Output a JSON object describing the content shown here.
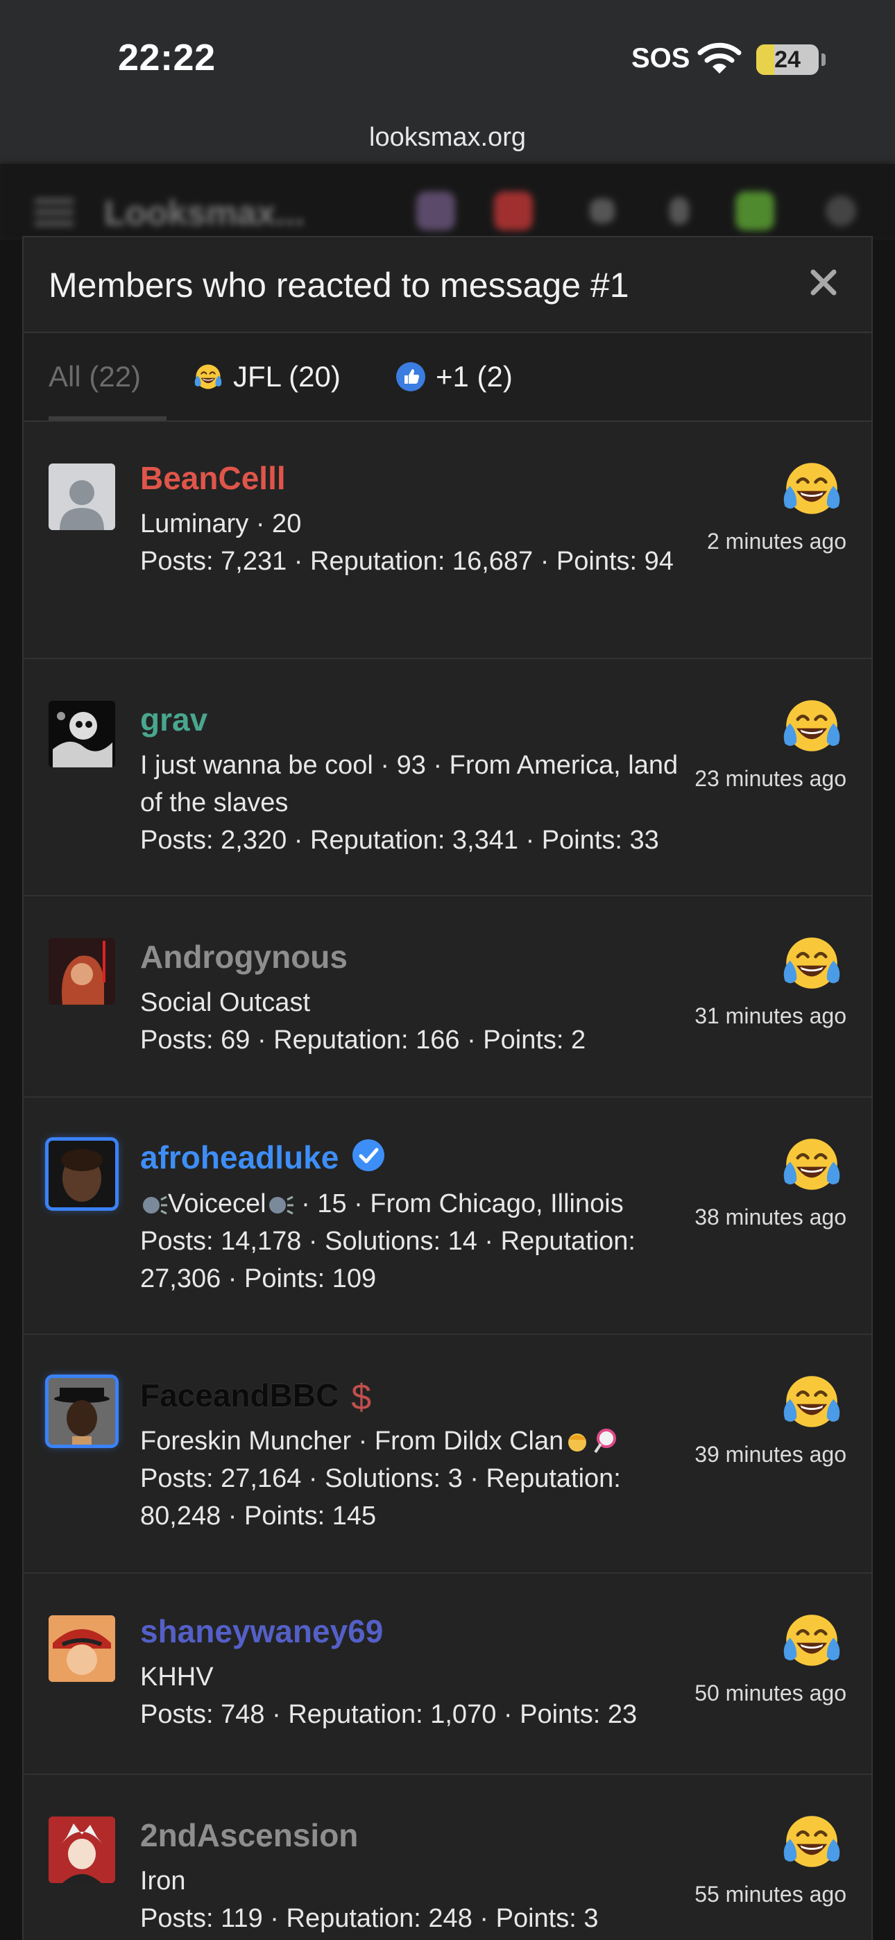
{
  "status_bar": {
    "time": "22:22",
    "sos": "SOS",
    "battery": "24"
  },
  "browser": {
    "url": "looksmax.org"
  },
  "site": {
    "logo": "Looksmax..."
  },
  "modal": {
    "title": "Members who reacted to message #1",
    "tabs": [
      {
        "label": "All (22)"
      },
      {
        "label": "JFL (20)",
        "icon": "laughing-crying-emoji-icon"
      },
      {
        "label": "+1 (2)",
        "icon": "thumbs-up-icon"
      }
    ]
  },
  "members": [
    {
      "name": "BeanCelll",
      "name_color": "#e0554a",
      "title": "Luminary · 20",
      "stats": "Posts: 7,231 · Reputation: 16,687 · Points: 94",
      "time": "2 minutes ago",
      "reaction": "laughing-crying-emoji-icon"
    },
    {
      "name": "grav",
      "name_color": "#4aa68e",
      "title": "I just wanna be cool · 93 · From America, land of the slaves",
      "stats": "Posts: 2,320 · Reputation: 3,341 · Points: 33",
      "time": "23 minutes ago",
      "reaction": "laughing-crying-emoji-icon"
    },
    {
      "name": "Androgynous",
      "name_color": "#8e8e8e",
      "title": "Social Outcast",
      "stats": "Posts: 69 · Reputation: 166 · Points: 2",
      "time": "31 minutes ago",
      "reaction": "laughing-crying-emoji-icon"
    },
    {
      "name": "afroheadluke",
      "name_color": "#3e8ef7",
      "title_a": "Voicecel",
      "title_b": " · 15 · From Chicago, Illinois",
      "stats": "Posts: 14,178 · Solutions: 14 · Reputation: 27,306 · Points: 109",
      "time": "38 minutes ago",
      "reaction": "laughing-crying-emoji-icon"
    },
    {
      "name": "FaceandBBC",
      "name_color": "#0b0b0b",
      "title": "Foreskin Muncher · From Dildx Clan",
      "stats": "Posts: 27,164 · Solutions: 3 · Reputation: 80,248 · Points: 145",
      "time": "39 minutes ago",
      "reaction": "laughing-crying-emoji-icon"
    },
    {
      "name": "shaneywaney69",
      "name_color": "#5460c8",
      "title": "KHHV",
      "stats": "Posts: 748 · Reputation: 1,070 · Points: 23",
      "time": "50 minutes ago",
      "reaction": "laughing-crying-emoji-icon"
    },
    {
      "name": "2ndAscension",
      "name_color": "#8e8e8e",
      "title": "Iron",
      "stats": "Posts: 119 · Reputation: 248 · Points: 3",
      "time": "55 minutes ago",
      "reaction": "laughing-crying-emoji-icon"
    }
  ]
}
